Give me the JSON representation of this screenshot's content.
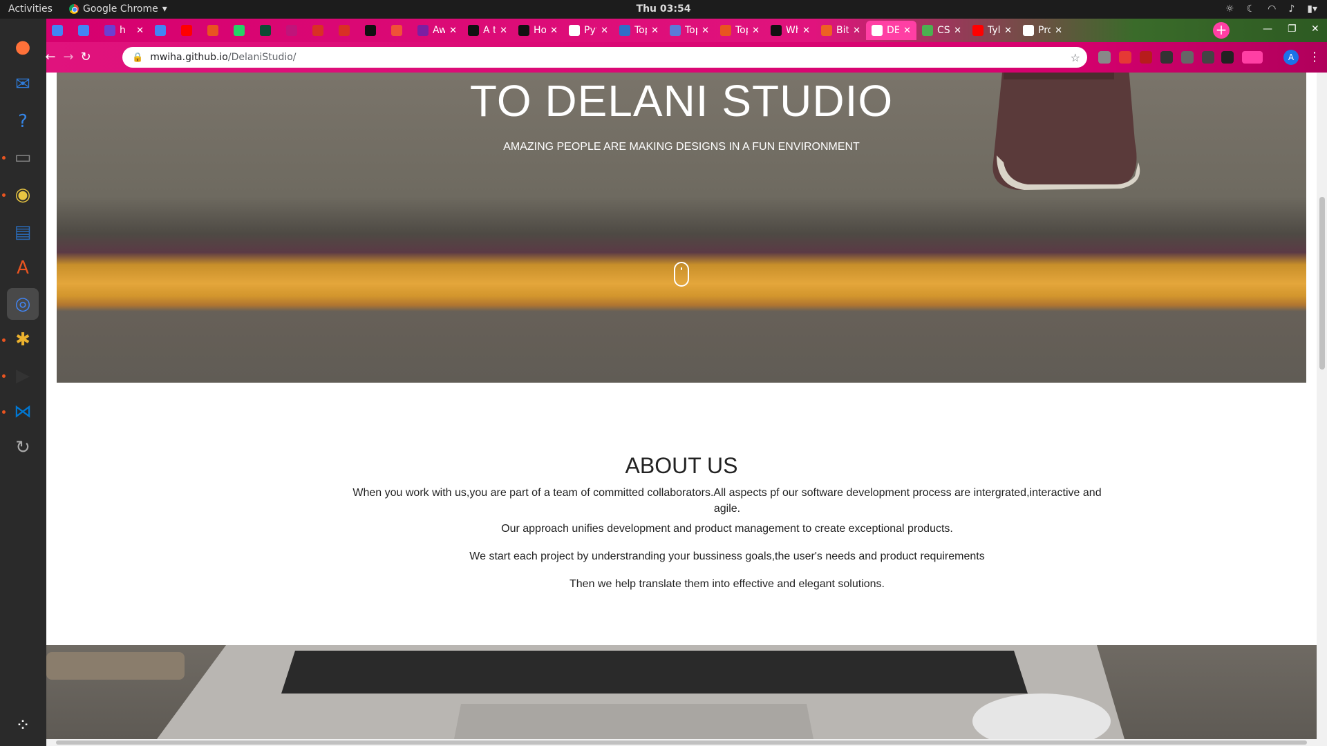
{
  "topbar": {
    "activities": "Activities",
    "app_name": "Google Chrome",
    "clock": "Thu 03:54"
  },
  "dock": {
    "apps": [
      {
        "name": "firefox-icon",
        "color": "#ff7139"
      },
      {
        "name": "thunderbird-icon",
        "color": "#2f7bd8"
      },
      {
        "name": "help-icon",
        "color": "#3584e4"
      },
      {
        "name": "files-icon",
        "color": "#8a8a8a"
      },
      {
        "name": "rhythmbox-icon",
        "color": "#e8c542"
      },
      {
        "name": "writer-icon",
        "color": "#2a6bb8"
      },
      {
        "name": "software-icon",
        "color": "#e95420"
      },
      {
        "name": "chrome-icon",
        "color": "#4285f4"
      },
      {
        "name": "slack-icon",
        "color": "#ecb22e"
      },
      {
        "name": "terminal-icon",
        "color": "#333333"
      },
      {
        "name": "vscode-icon",
        "color": "#0078d4"
      },
      {
        "name": "updater-icon",
        "color": "#aaaaaa"
      },
      {
        "name": "app-grid-icon",
        "color": "#ffffff"
      }
    ]
  },
  "tabs": [
    {
      "title": "",
      "icon": "docs-icon",
      "color": "#4285f4"
    },
    {
      "title": "",
      "icon": "docs-icon",
      "color": "#4285f4"
    },
    {
      "title": "h",
      "icon": "jetbrains-icon",
      "color": "#6c3fd1"
    },
    {
      "title": "",
      "icon": "docs-icon",
      "color": "#4285f4"
    },
    {
      "title": "",
      "icon": "youtube-icon",
      "color": "#ff0000"
    },
    {
      "title": "",
      "icon": "ubuntu-icon",
      "color": "#e95420"
    },
    {
      "title": "",
      "icon": "whatsapp-icon",
      "color": "#25d366"
    },
    {
      "title": "",
      "icon": "django-icon",
      "color": "#0c4b33"
    },
    {
      "title": "",
      "icon": "pin-icon",
      "color": "#c0147a"
    },
    {
      "title": "",
      "icon": "gmail-icon",
      "color": "#d93025"
    },
    {
      "title": "",
      "icon": "gmail-icon",
      "color": "#d93025"
    },
    {
      "title": "",
      "icon": "github-icon",
      "color": "#111111"
    },
    {
      "title": "",
      "icon": "swift-icon",
      "color": "#f05138"
    },
    {
      "title": "Aw",
      "icon": "w-icon",
      "color": "#7b1fa2"
    },
    {
      "title": "A te",
      "icon": "github-icon",
      "color": "#111111"
    },
    {
      "title": "Hov",
      "icon": "angular-icon",
      "color": "#111111"
    },
    {
      "title": "Pytl",
      "icon": "square-icon",
      "color": "#ffffff"
    },
    {
      "title": "Top",
      "icon": "el-icon",
      "color": "#2f6ec7"
    },
    {
      "title": "Top",
      "icon": "q-icon",
      "color": "#5a7bd8"
    },
    {
      "title": "Top",
      "icon": "ubuntu-icon",
      "color": "#e95420"
    },
    {
      "title": "Wh",
      "icon": "medium-icon",
      "color": "#111111"
    },
    {
      "title": "Bitl",
      "icon": "bit-icon",
      "color": "#ee6123"
    },
    {
      "title": "DEl",
      "icon": "globe-icon",
      "color": "#ffffff",
      "active": true
    },
    {
      "title": "CSS",
      "icon": "w3-icon",
      "color": "#4caf50"
    },
    {
      "title": "Tyle",
      "icon": "youtube-icon",
      "color": "#ff0000"
    },
    {
      "title": "Pro",
      "icon": "globe-icon",
      "color": "#ffffff"
    }
  ],
  "omnibox": {
    "host": "mwiha.github.io",
    "path": "/DelaniStudio/"
  },
  "profile_initial": "A",
  "page": {
    "hero_title": "TO DELANI STUDIO",
    "hero_subtitle": "AMAZING PEOPLE ARE MAKING DESIGNS IN A FUN ENVIRONMENT",
    "about_title": "ABOUT US",
    "about_paragraphs": [
      "When you work with us,you are part of a team of committed collaborators.All aspects pf our software development process are intergrated,interactive and agile.",
      "Our approach unifies development and product management to create exceptional products.",
      "We start each project by understranding your bussiness goals,the user's needs and product requirements",
      "Then we help translate them into effective and elegant solutions."
    ]
  },
  "colors": {
    "tab_strip_pink": "#e0137d",
    "active_tab": "#ff3fa4"
  }
}
